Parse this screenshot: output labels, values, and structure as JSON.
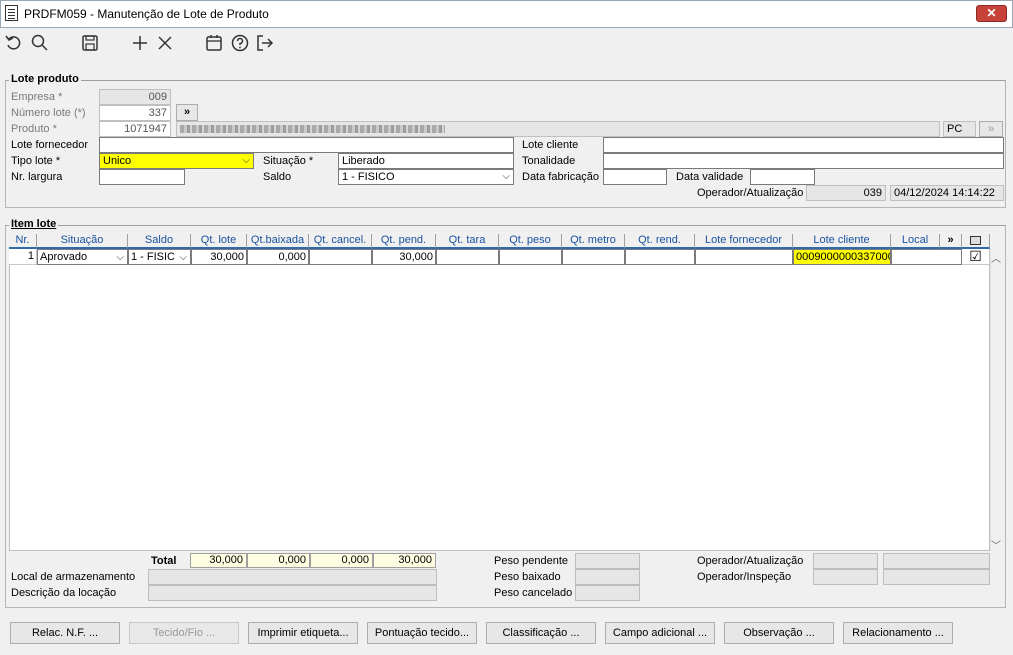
{
  "window": {
    "title": "PRDFM059 - Manutenção de Lote de Produto",
    "close": "✕"
  },
  "toolbar": {
    "icons": [
      "undo-icon",
      "search-icon",
      "save-icon",
      "add-icon",
      "delete-icon",
      "calendar-icon",
      "help-icon",
      "exit-icon"
    ]
  },
  "lote_produto": {
    "title": "Lote produto",
    "empresa_label": "Empresa *",
    "empresa_value": "009",
    "numero_lote_label": "Número lote (*)",
    "numero_lote_value": "337",
    "expand_symbol": "»",
    "produto_label": "Produto *",
    "produto_value": "1071947",
    "unidade_value": "PC",
    "lote_fornecedor_label": "Lote fornecedor",
    "lote_fornecedor_value": "",
    "lote_cliente_label": "Lote cliente",
    "lote_cliente_value": "",
    "tipo_lote_label": "Tipo lote *",
    "tipo_lote_value": "Unico",
    "situacao_label": "Situação *",
    "situacao_value": "Liberado",
    "tonalidade_label": "Tonalidade",
    "tonalidade_value": "",
    "nr_largura_label": "Nr. largura",
    "nr_largura_value": "",
    "saldo_label": "Saldo",
    "saldo_value": "1 - FISICO",
    "data_fabricacao_label": "Data fabricação",
    "data_fabricacao_value": "",
    "data_validade_label": "Data validade",
    "data_validade_value": "",
    "operador_label": "Operador/Atualização",
    "operador_value": "039",
    "atualizacao_value": "04/12/2024 14:14:22"
  },
  "item_lote": {
    "title": "Item lote",
    "columns": [
      "Nr.",
      "Situação",
      "Saldo",
      "Qt. lote",
      "Qt.baixada",
      "Qt. cancel.",
      "Qt. pend.",
      "Qt. tara",
      "Qt. peso",
      "Qt. metro",
      "Qt. rend.",
      "Lote fornecedor",
      "Lote cliente",
      "Local",
      "»"
    ],
    "rows": [
      {
        "nr": "1",
        "situacao": "Aprovado",
        "saldo": "1 - FISIC",
        "qt_lote": "30,000",
        "qt_baixada": "0,000",
        "qt_cancel": "",
        "qt_pend": "30,000",
        "qt_tara": "",
        "qt_peso": "",
        "qt_metro": "",
        "qt_rend": "",
        "lote_fornecedor": "",
        "lote_cliente": "0009000000337000",
        "local": "",
        "checked": "☑"
      }
    ],
    "total_label": "Total",
    "totals": {
      "qt_lote": "30,000",
      "qt_baixada": "0,000",
      "qt_cancel": "0,000",
      "qt_pend": "30,000"
    },
    "local_armazenamento_label": "Local de armazenamento",
    "descricao_locacao_label": "Descrição da locação",
    "peso_pendente_label": "Peso pendente",
    "peso_baixado_label": "Peso baixado",
    "peso_cancelado_label": "Peso cancelado",
    "operador_atualizacao_label": "Operador/Atualização",
    "operador_inspecao_label": "Operador/Inspeção"
  },
  "buttons": {
    "relac_nf": "Relac. N.F. ...",
    "tecido_fio": "Tecido/Fio ...",
    "imprimir_etiqueta": "Imprimir etiqueta...",
    "pontuacao_tecido": "Pontuação tecido...",
    "classificacao": "Classificação ...",
    "campo_adicional": "Campo adicional ...",
    "observacao": "Observação ...",
    "relacionamento": "Relacionamento ..."
  }
}
